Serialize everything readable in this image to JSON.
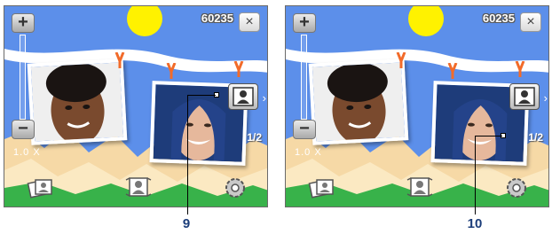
{
  "screens": [
    {
      "score": "60235",
      "zoom_in_label": "+",
      "zoom_out_label": "−",
      "zoom_level": "1.0 X",
      "close_label": "×",
      "page_count": "1/2",
      "next_arrow": "›"
    },
    {
      "score": "60235",
      "zoom_in_label": "+",
      "zoom_out_label": "−",
      "zoom_level": "1.0 X",
      "close_label": "×",
      "page_count": "1/2",
      "next_arrow": "›"
    }
  ],
  "callouts": [
    "9",
    "10"
  ],
  "colors": {
    "sky": "#5c8fea",
    "sun": "#fff200",
    "sand": "#f6d9a6",
    "grass": "#38b24a",
    "pin": "#f26b2a",
    "callout_text": "#1b3d7a"
  },
  "icons": [
    "zoom-in-icon",
    "zoom-out-icon",
    "close-icon",
    "frame-icon",
    "album-icon",
    "theme-icon",
    "settings-icon"
  ]
}
